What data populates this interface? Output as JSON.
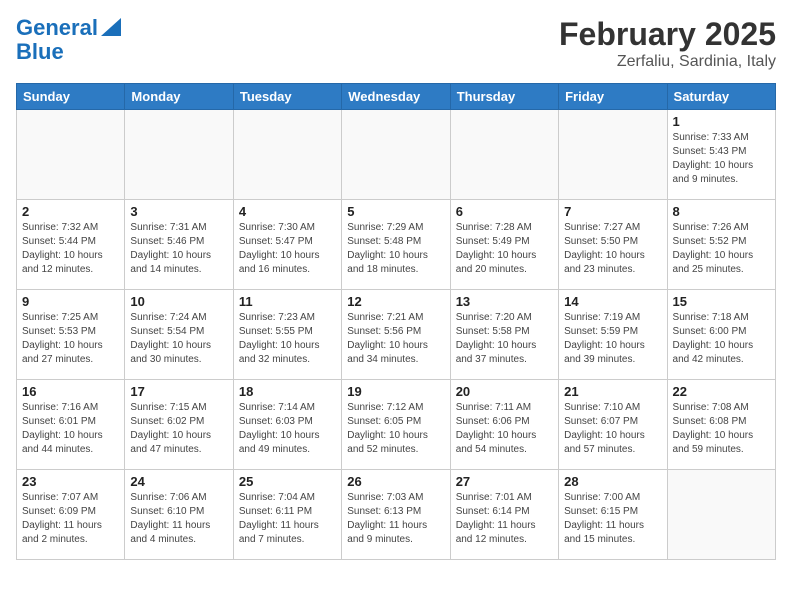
{
  "header": {
    "logo_line1": "General",
    "logo_line2": "Blue",
    "month_title": "February 2025",
    "subtitle": "Zerfaliu, Sardinia, Italy"
  },
  "weekdays": [
    "Sunday",
    "Monday",
    "Tuesday",
    "Wednesday",
    "Thursday",
    "Friday",
    "Saturday"
  ],
  "weeks": [
    [
      {
        "day": "",
        "info": ""
      },
      {
        "day": "",
        "info": ""
      },
      {
        "day": "",
        "info": ""
      },
      {
        "day": "",
        "info": ""
      },
      {
        "day": "",
        "info": ""
      },
      {
        "day": "",
        "info": ""
      },
      {
        "day": "1",
        "info": "Sunrise: 7:33 AM\nSunset: 5:43 PM\nDaylight: 10 hours\nand 9 minutes."
      }
    ],
    [
      {
        "day": "2",
        "info": "Sunrise: 7:32 AM\nSunset: 5:44 PM\nDaylight: 10 hours\nand 12 minutes."
      },
      {
        "day": "3",
        "info": "Sunrise: 7:31 AM\nSunset: 5:46 PM\nDaylight: 10 hours\nand 14 minutes."
      },
      {
        "day": "4",
        "info": "Sunrise: 7:30 AM\nSunset: 5:47 PM\nDaylight: 10 hours\nand 16 minutes."
      },
      {
        "day": "5",
        "info": "Sunrise: 7:29 AM\nSunset: 5:48 PM\nDaylight: 10 hours\nand 18 minutes."
      },
      {
        "day": "6",
        "info": "Sunrise: 7:28 AM\nSunset: 5:49 PM\nDaylight: 10 hours\nand 20 minutes."
      },
      {
        "day": "7",
        "info": "Sunrise: 7:27 AM\nSunset: 5:50 PM\nDaylight: 10 hours\nand 23 minutes."
      },
      {
        "day": "8",
        "info": "Sunrise: 7:26 AM\nSunset: 5:52 PM\nDaylight: 10 hours\nand 25 minutes."
      }
    ],
    [
      {
        "day": "9",
        "info": "Sunrise: 7:25 AM\nSunset: 5:53 PM\nDaylight: 10 hours\nand 27 minutes."
      },
      {
        "day": "10",
        "info": "Sunrise: 7:24 AM\nSunset: 5:54 PM\nDaylight: 10 hours\nand 30 minutes."
      },
      {
        "day": "11",
        "info": "Sunrise: 7:23 AM\nSunset: 5:55 PM\nDaylight: 10 hours\nand 32 minutes."
      },
      {
        "day": "12",
        "info": "Sunrise: 7:21 AM\nSunset: 5:56 PM\nDaylight: 10 hours\nand 34 minutes."
      },
      {
        "day": "13",
        "info": "Sunrise: 7:20 AM\nSunset: 5:58 PM\nDaylight: 10 hours\nand 37 minutes."
      },
      {
        "day": "14",
        "info": "Sunrise: 7:19 AM\nSunset: 5:59 PM\nDaylight: 10 hours\nand 39 minutes."
      },
      {
        "day": "15",
        "info": "Sunrise: 7:18 AM\nSunset: 6:00 PM\nDaylight: 10 hours\nand 42 minutes."
      }
    ],
    [
      {
        "day": "16",
        "info": "Sunrise: 7:16 AM\nSunset: 6:01 PM\nDaylight: 10 hours\nand 44 minutes."
      },
      {
        "day": "17",
        "info": "Sunrise: 7:15 AM\nSunset: 6:02 PM\nDaylight: 10 hours\nand 47 minutes."
      },
      {
        "day": "18",
        "info": "Sunrise: 7:14 AM\nSunset: 6:03 PM\nDaylight: 10 hours\nand 49 minutes."
      },
      {
        "day": "19",
        "info": "Sunrise: 7:12 AM\nSunset: 6:05 PM\nDaylight: 10 hours\nand 52 minutes."
      },
      {
        "day": "20",
        "info": "Sunrise: 7:11 AM\nSunset: 6:06 PM\nDaylight: 10 hours\nand 54 minutes."
      },
      {
        "day": "21",
        "info": "Sunrise: 7:10 AM\nSunset: 6:07 PM\nDaylight: 10 hours\nand 57 minutes."
      },
      {
        "day": "22",
        "info": "Sunrise: 7:08 AM\nSunset: 6:08 PM\nDaylight: 10 hours\nand 59 minutes."
      }
    ],
    [
      {
        "day": "23",
        "info": "Sunrise: 7:07 AM\nSunset: 6:09 PM\nDaylight: 11 hours\nand 2 minutes."
      },
      {
        "day": "24",
        "info": "Sunrise: 7:06 AM\nSunset: 6:10 PM\nDaylight: 11 hours\nand 4 minutes."
      },
      {
        "day": "25",
        "info": "Sunrise: 7:04 AM\nSunset: 6:11 PM\nDaylight: 11 hours\nand 7 minutes."
      },
      {
        "day": "26",
        "info": "Sunrise: 7:03 AM\nSunset: 6:13 PM\nDaylight: 11 hours\nand 9 minutes."
      },
      {
        "day": "27",
        "info": "Sunrise: 7:01 AM\nSunset: 6:14 PM\nDaylight: 11 hours\nand 12 minutes."
      },
      {
        "day": "28",
        "info": "Sunrise: 7:00 AM\nSunset: 6:15 PM\nDaylight: 11 hours\nand 15 minutes."
      },
      {
        "day": "",
        "info": ""
      }
    ]
  ]
}
